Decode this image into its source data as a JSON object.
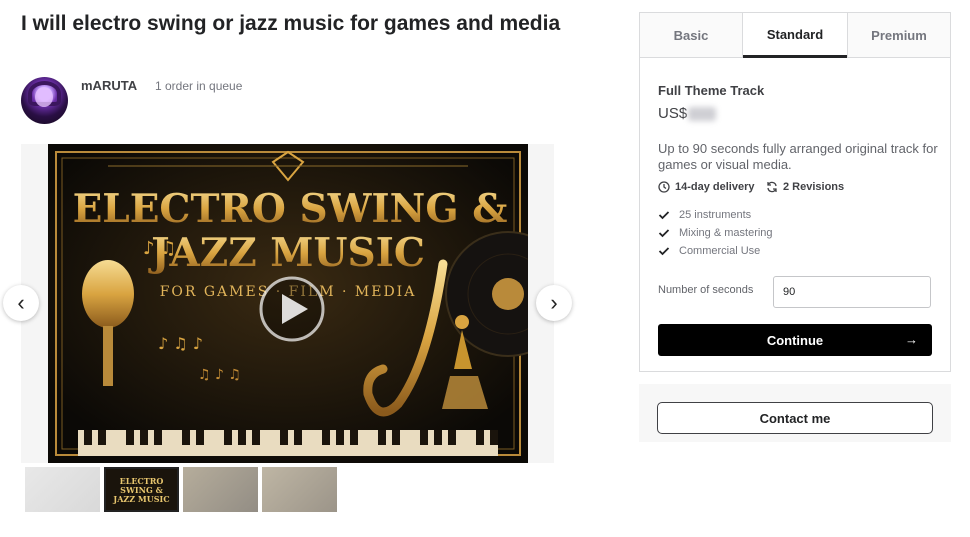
{
  "gig": {
    "title": "I will electro swing or jazz music for games and media"
  },
  "seller": {
    "name": "mARUTA",
    "queue": "1 order in queue"
  },
  "gallery": {
    "main": {
      "headline_line1": "ELECTRO SWING &",
      "headline_line2": "JAZZ MUSIC",
      "subline": "FOR GAMES · FILM · MEDIA",
      "play_icon": "play-icon"
    },
    "prev_icon": "chevron-left-icon",
    "next_icon": "chevron-right-icon",
    "thumbnails": [
      {
        "label": ""
      },
      {
        "label": "ELECTRO SWING & JAZZ MUSIC",
        "selected": true
      },
      {
        "label": ""
      },
      {
        "label": ""
      }
    ]
  },
  "package": {
    "tabs": [
      {
        "label": "Basic"
      },
      {
        "label": "Standard",
        "active": true
      },
      {
        "label": "Premium"
      }
    ],
    "title": "Full Theme Track",
    "price_prefix": "US$",
    "description": "Up to 90 seconds fully arranged original track for games or visual media.",
    "delivery": "14-day delivery",
    "revisions": "2 Revisions",
    "features": [
      {
        "label": "25 instruments"
      },
      {
        "label": "Mixing & mastering"
      },
      {
        "label": "Commercial Use"
      }
    ],
    "quantity_label": "Number of seconds",
    "quantity_value": "90",
    "continue_label": "Continue",
    "continue_icon": "arrow-right-icon"
  },
  "contact": {
    "label": "Contact me"
  },
  "colors": {
    "accent": "#222325",
    "button_bg": "#000000",
    "gold": "#d9a441"
  }
}
